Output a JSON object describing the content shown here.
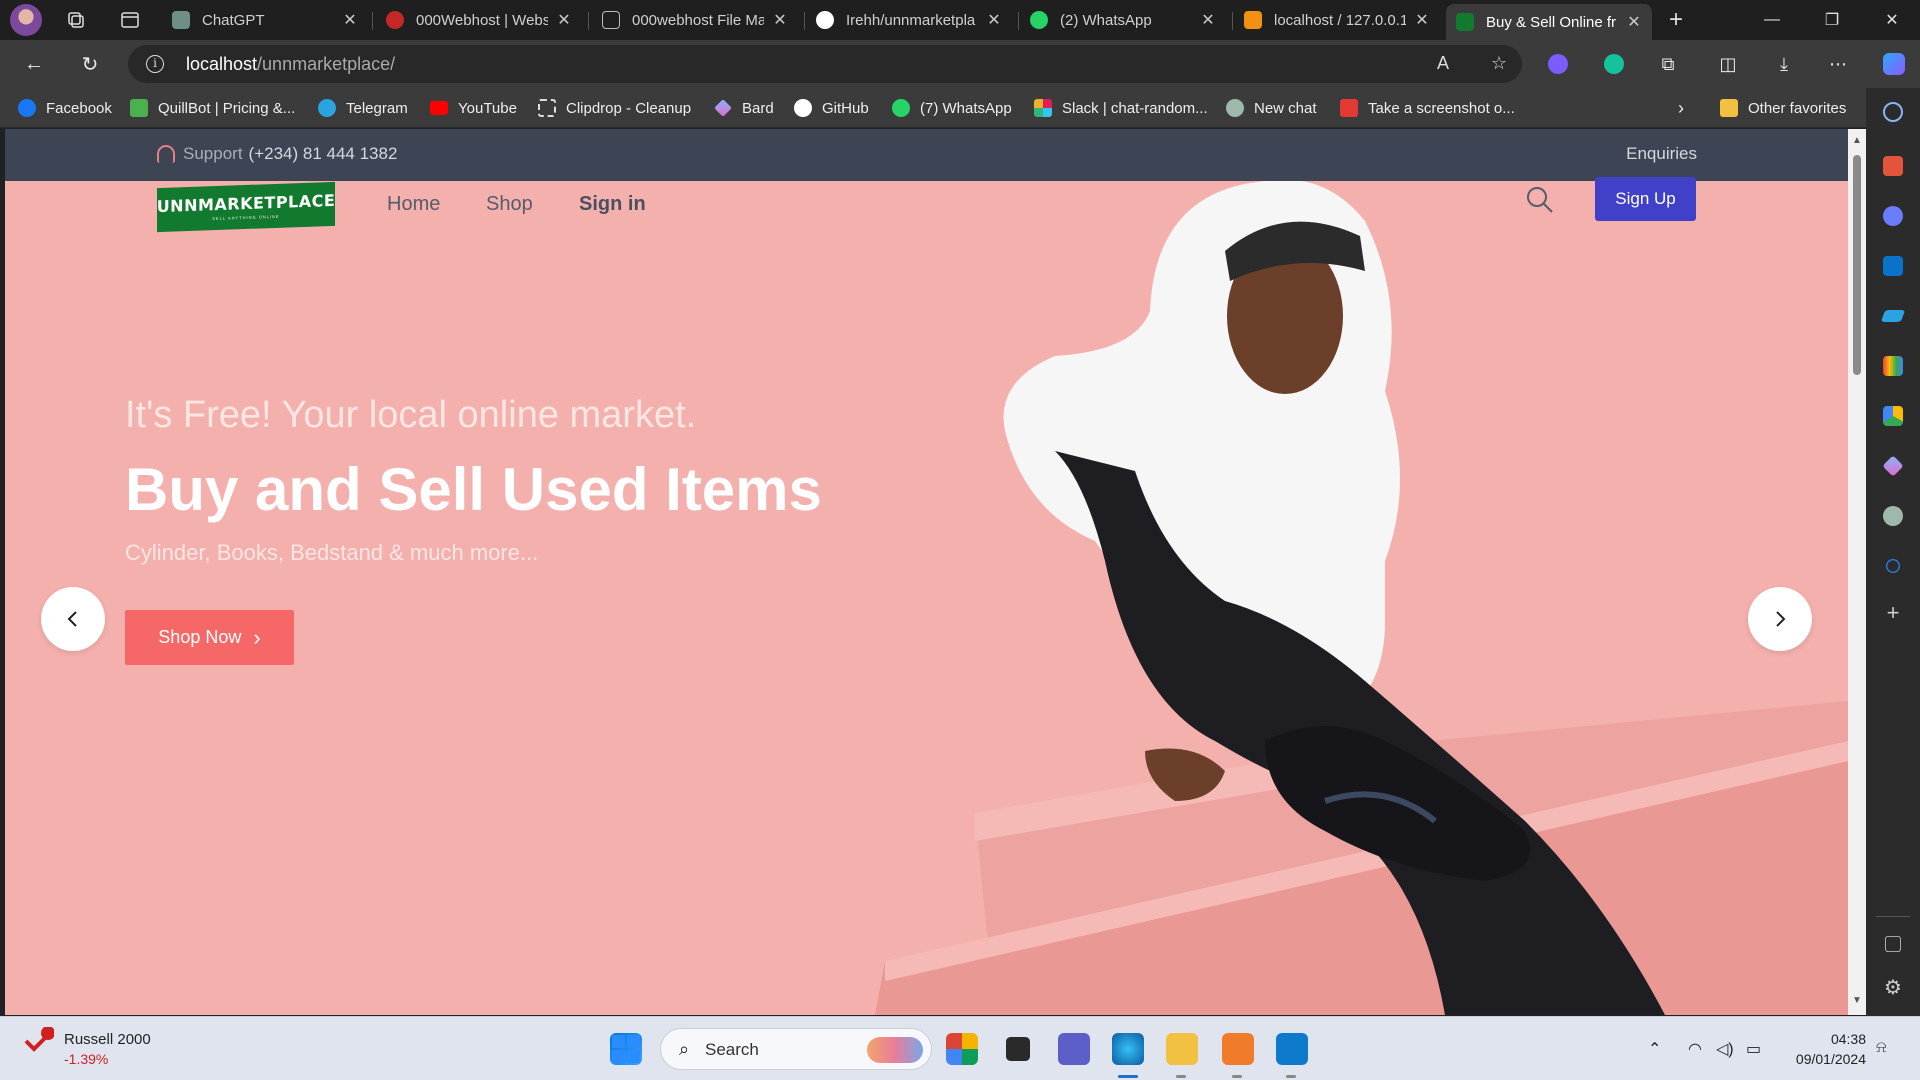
{
  "browser": {
    "tabs": [
      {
        "label": "ChatGPT",
        "color": "#6f8f86"
      },
      {
        "label": "000Webhost | Webs",
        "color": "#c62828"
      },
      {
        "label": "000webhost File Ma",
        "color": "#bbbbbb"
      },
      {
        "label": "Irehh/unnmarketpla",
        "color": "#ffffff"
      },
      {
        "label": "(2) WhatsApp",
        "color": "#25d366"
      },
      {
        "label": "localhost / 127.0.0.1",
        "color": "#f29111"
      },
      {
        "label": "Buy & Sell Online fr",
        "color": "#127a2e",
        "active": true
      }
    ],
    "url_host": "localhost",
    "url_path": "/unnmarketplace/",
    "bookmarks": [
      {
        "label": "Facebook",
        "color": "#1877f2"
      },
      {
        "label": "QuillBot | Pricing &...",
        "color": "#4caf50"
      },
      {
        "label": "Telegram",
        "color": "#2aa3e0"
      },
      {
        "label": "YouTube",
        "color": "#ff0000"
      },
      {
        "label": "Clipdrop - Cleanup",
        "color": "#dddddd"
      },
      {
        "label": "Bard",
        "color": "#8ab4f8"
      },
      {
        "label": "GitHub",
        "color": "#ffffff"
      },
      {
        "label": "(7) WhatsApp",
        "color": "#25d366"
      },
      {
        "label": "Slack | chat-random...",
        "color": "#e01e5a"
      },
      {
        "label": "New chat",
        "color": "#9fb8ac"
      },
      {
        "label": "Take a screenshot o...",
        "color": "#e53935"
      }
    ],
    "other_favorites": "Other favorites"
  },
  "page": {
    "support_label": "Support",
    "support_phone": "(+234) 81 444 1382",
    "enquiries": "Enquiries",
    "logo_text": "UNNMARKETPLACE",
    "logo_sub": "SELL ANYTHING ONLINE",
    "nav": {
      "home": "Home",
      "shop": "Shop",
      "signin": "Sign in"
    },
    "signup": "Sign Up",
    "hero": {
      "tagline": "It's Free! Your local online market.",
      "headline": "Buy and Sell Used Items",
      "subline": "Cylinder, Books, Bedstand & much more...",
      "cta": "Shop Now"
    },
    "colors": {
      "hero_bg": "#f4b0ac",
      "topbar": "#3d4454",
      "cta": "#f66868",
      "signup": "#4040c8",
      "logo": "#127a2e"
    }
  },
  "taskbar": {
    "stock_name": "Russell 2000",
    "stock_change": "-1.39%",
    "search_label": "Search",
    "time": "04:38",
    "date": "09/01/2024"
  }
}
